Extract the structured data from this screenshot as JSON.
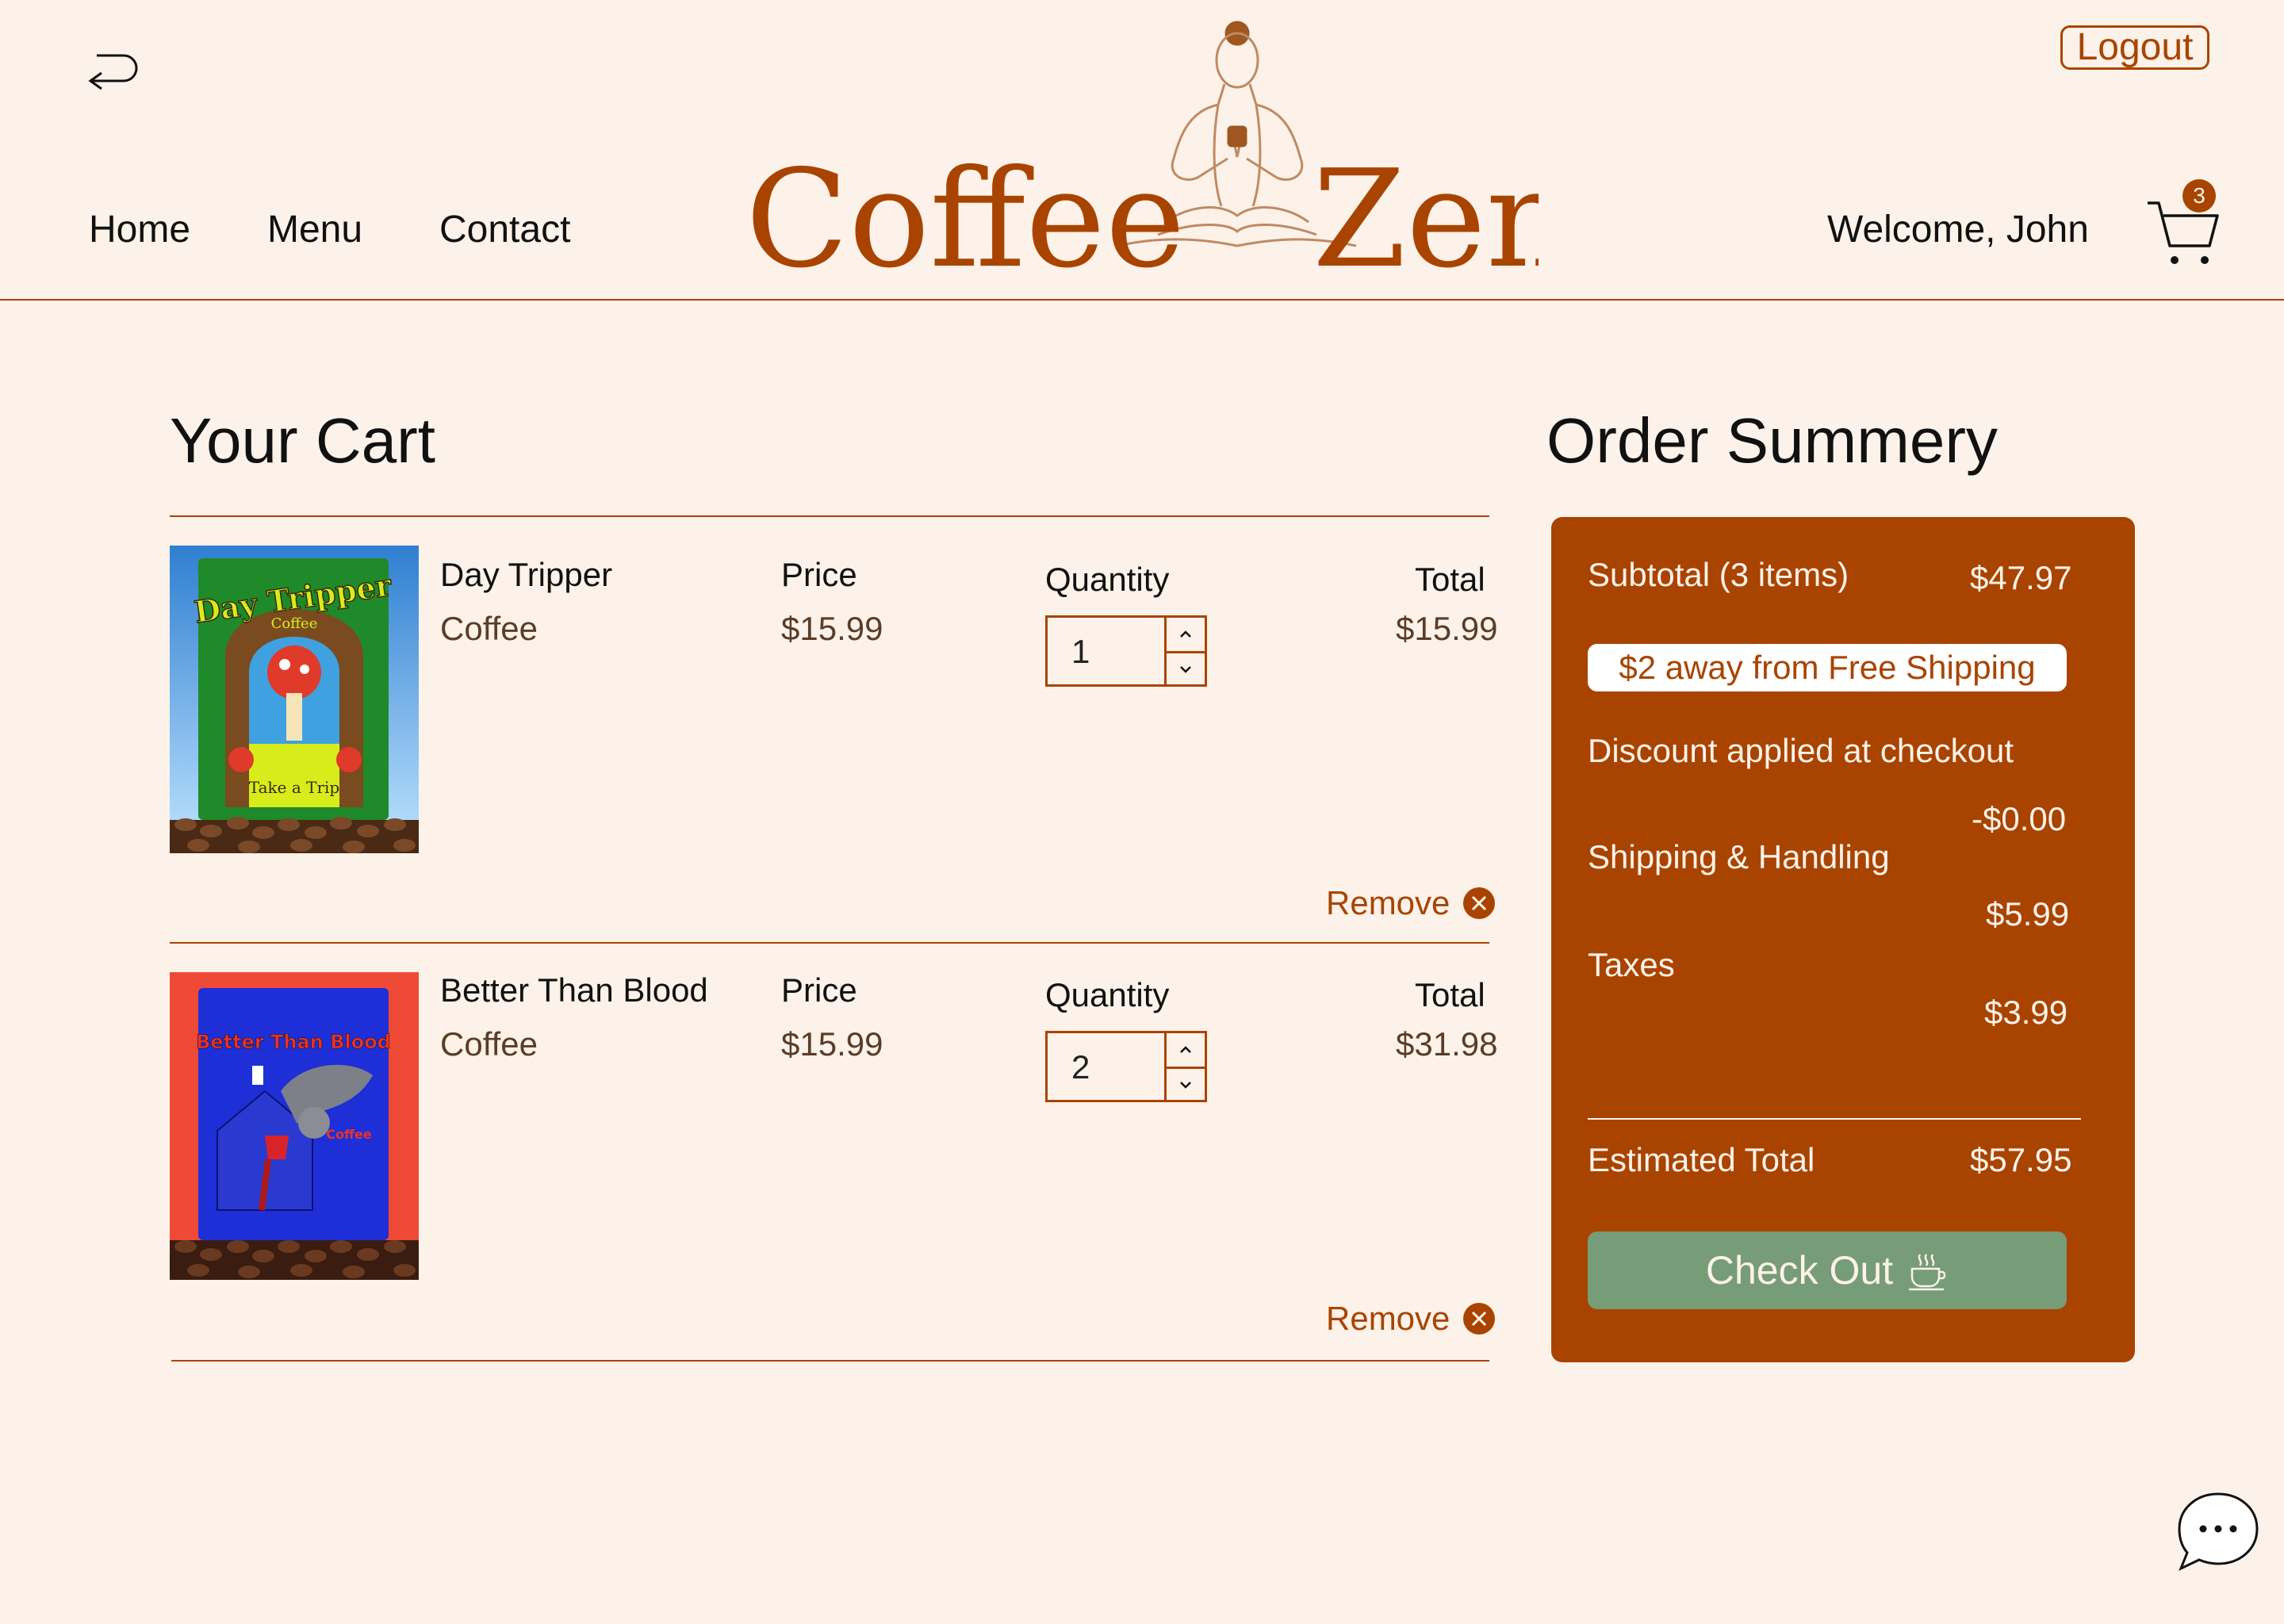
{
  "header": {
    "logout_label": "Logout",
    "nav": [
      "Home",
      "Menu",
      "Contact"
    ],
    "logo_text_left": "Coffee",
    "logo_text_right": "Zen",
    "welcome": "Welcome, John",
    "cart_count": "3"
  },
  "cart": {
    "title": "Your Cart",
    "items": [
      {
        "name": "Day Tripper",
        "category": "Coffee",
        "price_label": "Price",
        "price": "$15.99",
        "quantity_label": "Quantity",
        "quantity": "1",
        "total_label": "Total",
        "total": "$15.99",
        "remove_label": "Remove",
        "image": {
          "title": "Day Tripper",
          "subtitle": "Coffee",
          "bottom": "Take a Trip",
          "bg": "#3b8fd6",
          "accent": "#c7e317"
        }
      },
      {
        "name": "Better Than Blood",
        "category": "Coffee",
        "price_label": "Price",
        "price": "$15.99",
        "quantity_label": "Quantity",
        "quantity": "2",
        "total_label": "Total",
        "total": "$31.98",
        "remove_label": "Remove",
        "image": {
          "title": "Better Than Blood",
          "subtitle": "Coffee",
          "bg": "#e8442f",
          "accent": "#1f2fd8"
        }
      }
    ]
  },
  "summary": {
    "title": "Order Summery",
    "subtotal_label": "Subtotal (3 items)",
    "subtotal": "$47.97",
    "free_shipping_note": "$2 away from Free Shipping",
    "discount_label": "Discount applied at checkout",
    "discount": "-$0.00",
    "shipping_label": "Shipping & Handling",
    "shipping": "$5.99",
    "taxes_label": "Taxes",
    "taxes": "$3.99",
    "total_label": "Estimated Total",
    "total": "$57.95",
    "checkout_label": "Check Out"
  },
  "colors": {
    "background": "#fcf2e9",
    "brand": "#a94400",
    "checkout": "#769c78"
  },
  "icons": {
    "back": "return-arrow-icon",
    "cart": "shopping-cart-icon",
    "remove": "close-circle-icon",
    "checkout": "coffee-cup-icon",
    "chat": "chat-bubble-icon"
  }
}
